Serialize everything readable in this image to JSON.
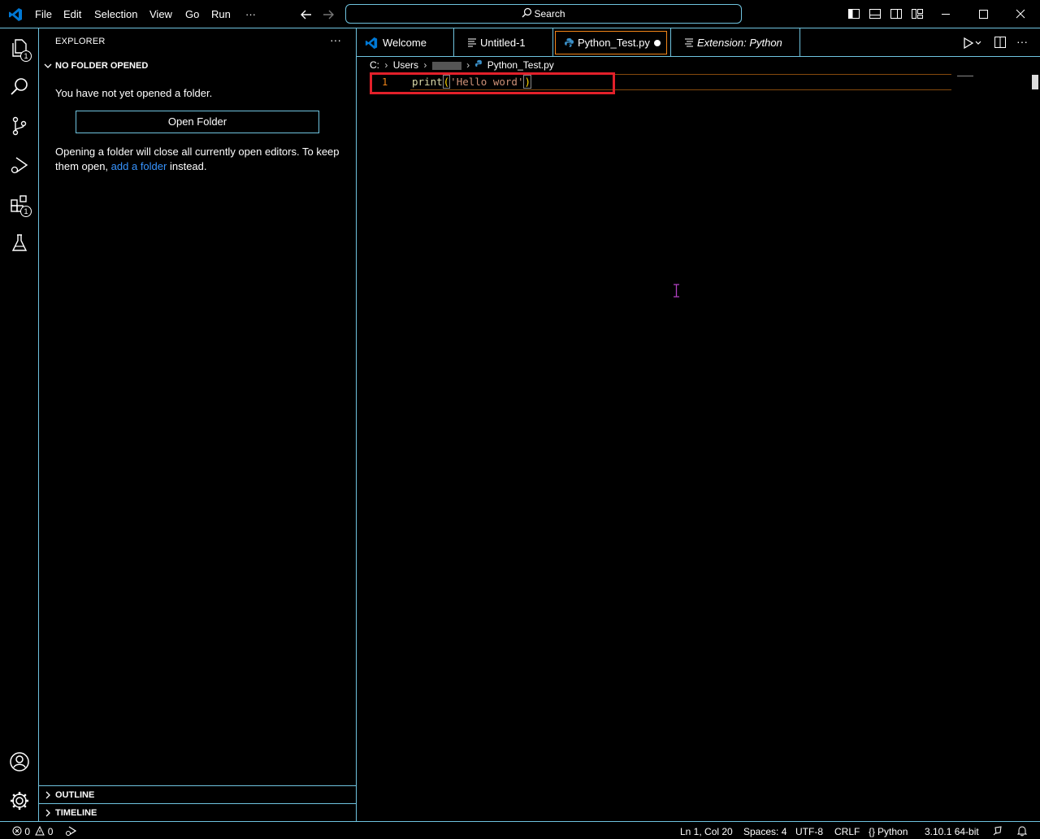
{
  "menu": {
    "file": "File",
    "edit": "Edit",
    "selection": "Selection",
    "view": "View",
    "go": "Go",
    "run": "Run",
    "more": "···"
  },
  "search": {
    "label": "Search"
  },
  "activity": {
    "explorer_badge": "1",
    "extensions_badge": "1"
  },
  "sidebar": {
    "title": "EXPLORER",
    "more": "···",
    "no_folder_header": "NO FOLDER OPENED",
    "no_folder_message": "You have not yet opened a folder.",
    "open_folder_button": "Open Folder",
    "opening_message_1": "Opening a folder will close all currently open editors. To keep them open,",
    "add_folder_link": "add a folder",
    "opening_message_2": "instead.",
    "outline": "OUTLINE",
    "timeline": "TIMELINE"
  },
  "tabs": [
    {
      "label": "Welcome",
      "icon": "vscode-logo-icon"
    },
    {
      "label": "Untitled-1",
      "icon": "file-lines-icon"
    },
    {
      "label": "Python_Test.py",
      "icon": "python-icon",
      "dirty": true,
      "active": true
    },
    {
      "label": "Extension: Python",
      "icon": "extension-page-icon",
      "italic": true
    }
  ],
  "breadcrumb": {
    "drive": "C:",
    "users": "Users",
    "file": "Python_Test.py"
  },
  "editor": {
    "line_number": "1",
    "code_fn": "print",
    "code_open": "(",
    "code_str": "'Hello word'",
    "code_close": ")"
  },
  "statusbar": {
    "errors": "0",
    "warnings": "0",
    "position": "Ln 1, Col 20",
    "spaces": "Spaces: 4",
    "encoding": "UTF-8",
    "eol": "CRLF",
    "language": "Python",
    "interpreter": "3.10.1 64-bit"
  },
  "colors": {
    "accent_border": "#6fc3df",
    "active_border": "#f38518",
    "highlight_box": "#e2202a",
    "link": "#3794ff",
    "vscode_blue": "#0078d4"
  }
}
